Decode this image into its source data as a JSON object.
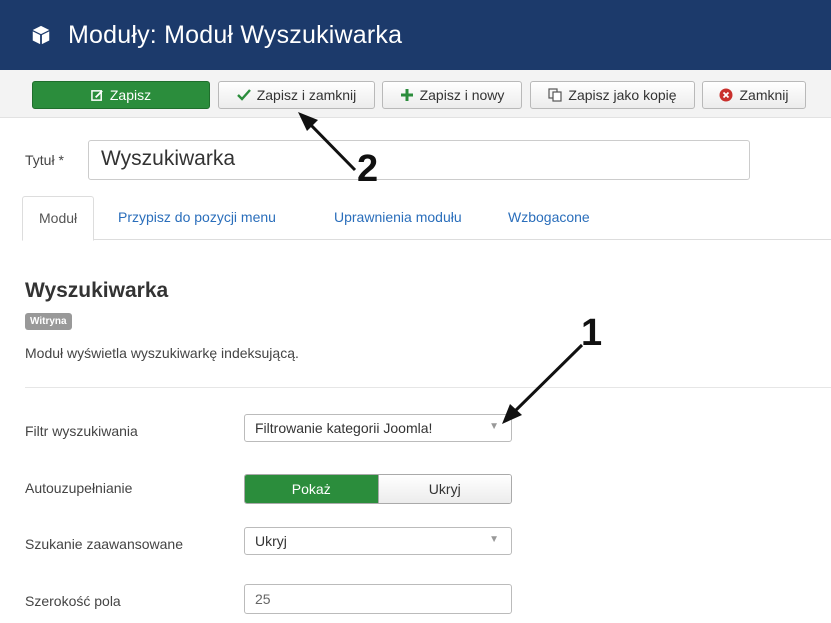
{
  "header": {
    "title": "Moduły: Moduł Wyszukiwarka"
  },
  "toolbar": {
    "save": "Zapisz",
    "save_close": "Zapisz i zamknij",
    "save_new": "Zapisz i nowy",
    "save_copy": "Zapisz jako kopię",
    "close": "Zamknij"
  },
  "form": {
    "title_label": "Tytuł *",
    "title_value": "Wyszukiwarka"
  },
  "tabs": [
    "Moduł",
    "Przypisz do pozycji menu",
    "Uprawnienia modułu",
    "Wzbogacone"
  ],
  "module": {
    "heading": "Wyszukiwarka",
    "badge": "Witryna",
    "description": "Moduł wyświetla wyszukiwarkę indeksującą."
  },
  "fields": {
    "filter_label": "Filtr wyszukiwania",
    "filter_value": "Filtrowanie kategorii Joomla!",
    "autocomplete_label": "Autouzupełnianie",
    "autocomplete_show": "Pokaż",
    "autocomplete_hide": "Ukryj",
    "advanced_label": "Szukanie zaawansowane",
    "advanced_value": "Ukryj",
    "width_label": "Szerokość pola",
    "width_value": "25"
  },
  "annotations": {
    "one": "1",
    "two": "2"
  },
  "colors": {
    "header": "#1c3a6b",
    "save": "#2b8d3c",
    "link": "#2a6ebb"
  }
}
